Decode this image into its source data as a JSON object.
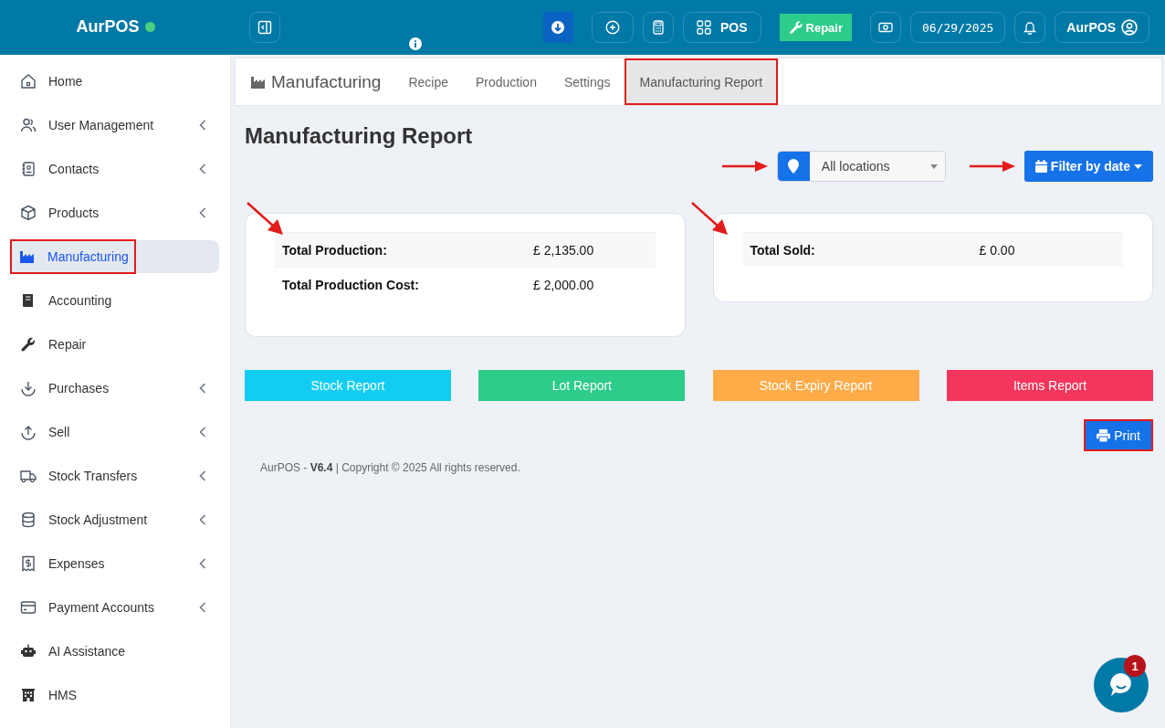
{
  "brand": {
    "name": "AurPOS",
    "online": true
  },
  "topbar": {
    "buttons": [
      {
        "kind": "download"
      },
      {
        "kind": "add"
      },
      {
        "kind": "calculator"
      },
      {
        "kind": "pos",
        "label": "POS"
      },
      {
        "kind": "repair",
        "label": "Repair"
      },
      {
        "kind": "cash"
      },
      {
        "kind": "date",
        "label": "06/29/2025"
      },
      {
        "kind": "bell"
      },
      {
        "kind": "user",
        "label": "AurPOS"
      }
    ]
  },
  "sidebar": {
    "items": [
      {
        "label": "Home",
        "selected": false,
        "highlighted": false,
        "submenu": false
      },
      {
        "label": "User Management",
        "selected": false,
        "highlighted": false,
        "submenu": true
      },
      {
        "label": "Contacts",
        "selected": false,
        "highlighted": false,
        "submenu": true
      },
      {
        "label": "Products",
        "selected": false,
        "highlighted": false,
        "submenu": true
      },
      {
        "label": "Manufacturing",
        "selected": true,
        "highlighted": true,
        "submenu": false
      },
      {
        "label": "Accounting",
        "selected": false,
        "highlighted": false,
        "submenu": false
      },
      {
        "label": "Repair",
        "selected": false,
        "highlighted": false,
        "submenu": false
      },
      {
        "label": "Purchases",
        "selected": false,
        "highlighted": false,
        "submenu": true
      },
      {
        "label": "Sell",
        "selected": false,
        "highlighted": false,
        "submenu": true
      },
      {
        "label": "Stock Transfers",
        "selected": false,
        "highlighted": false,
        "submenu": true
      },
      {
        "label": "Stock Adjustment",
        "selected": false,
        "highlighted": false,
        "submenu": true
      },
      {
        "label": "Expenses",
        "selected": false,
        "highlighted": false,
        "submenu": true
      },
      {
        "label": "Payment Accounts",
        "selected": false,
        "highlighted": false,
        "submenu": true
      },
      {
        "label": "AI Assistance",
        "selected": false,
        "highlighted": false,
        "submenu": false
      },
      {
        "label": "HMS",
        "selected": false,
        "highlighted": false,
        "submenu": false
      }
    ]
  },
  "module_nav": {
    "title": "Manufacturing",
    "tabs": [
      {
        "label": "Recipe",
        "selected": false,
        "highlighted": false
      },
      {
        "label": "Production",
        "selected": false,
        "highlighted": false
      },
      {
        "label": "Settings",
        "selected": false,
        "highlighted": false
      },
      {
        "label": "Manufacturing Report",
        "selected": true,
        "highlighted": true
      }
    ]
  },
  "page_title": "Manufacturing Report",
  "filters": {
    "location": {
      "value": "All locations",
      "arrow": true
    },
    "date": {
      "label": "Filter by date",
      "arrow": true
    }
  },
  "cards": [
    {
      "arrow": true,
      "rows": [
        {
          "label": "Total Production:",
          "value": "£ 2,135.00"
        },
        {
          "label": "Total Production Cost:",
          "value": "£ 2,000.00"
        }
      ]
    },
    {
      "arrow": true,
      "rows": [
        {
          "label": "Total Sold:",
          "value": "£ 0.00"
        }
      ]
    }
  ],
  "report_buttons": [
    {
      "label": "Stock Report",
      "color": "#12cdf1"
    },
    {
      "label": "Lot Report",
      "color": "#2ecc8a"
    },
    {
      "label": "Stock Expiry Report",
      "color": "#ffab47"
    },
    {
      "label": "Items Report",
      "color": "#f5365c"
    }
  ],
  "print_button": {
    "label": "Print",
    "highlighted": true
  },
  "footer": "AurPOS - **V6.4** | Copyright © 2025 All rights reserved.",
  "chat": {
    "badge": "1"
  }
}
